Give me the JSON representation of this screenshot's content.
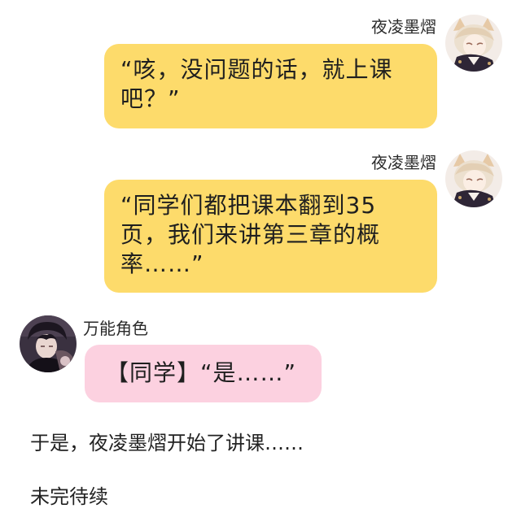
{
  "messages": [
    {
      "sender": "夜凌墨熠",
      "side": "right",
      "bubble_color": "#fddb6b",
      "avatar_icon": "anime-girl-cat-ears-avatar-icon",
      "lines": [
        "“咳，没问题的话，就上课",
        "吧？”"
      ]
    },
    {
      "sender": "夜凌墨熠",
      "side": "right",
      "bubble_color": "#fddb6b",
      "avatar_icon": "anime-girl-cat-ears-avatar-icon",
      "lines": [
        "“同学们都把课本翻到35",
        "页，我们来讲第三章的概",
        "率……”"
      ]
    },
    {
      "sender": "万能角色",
      "side": "left",
      "bubble_color": "#fcd1e0",
      "avatar_icon": "anime-boy-dark-avatar-icon",
      "lines": [
        "【同学】“是……”"
      ]
    }
  ],
  "narration": [
    "于是，夜凌墨熠开始了讲课……",
    "未完待续"
  ]
}
